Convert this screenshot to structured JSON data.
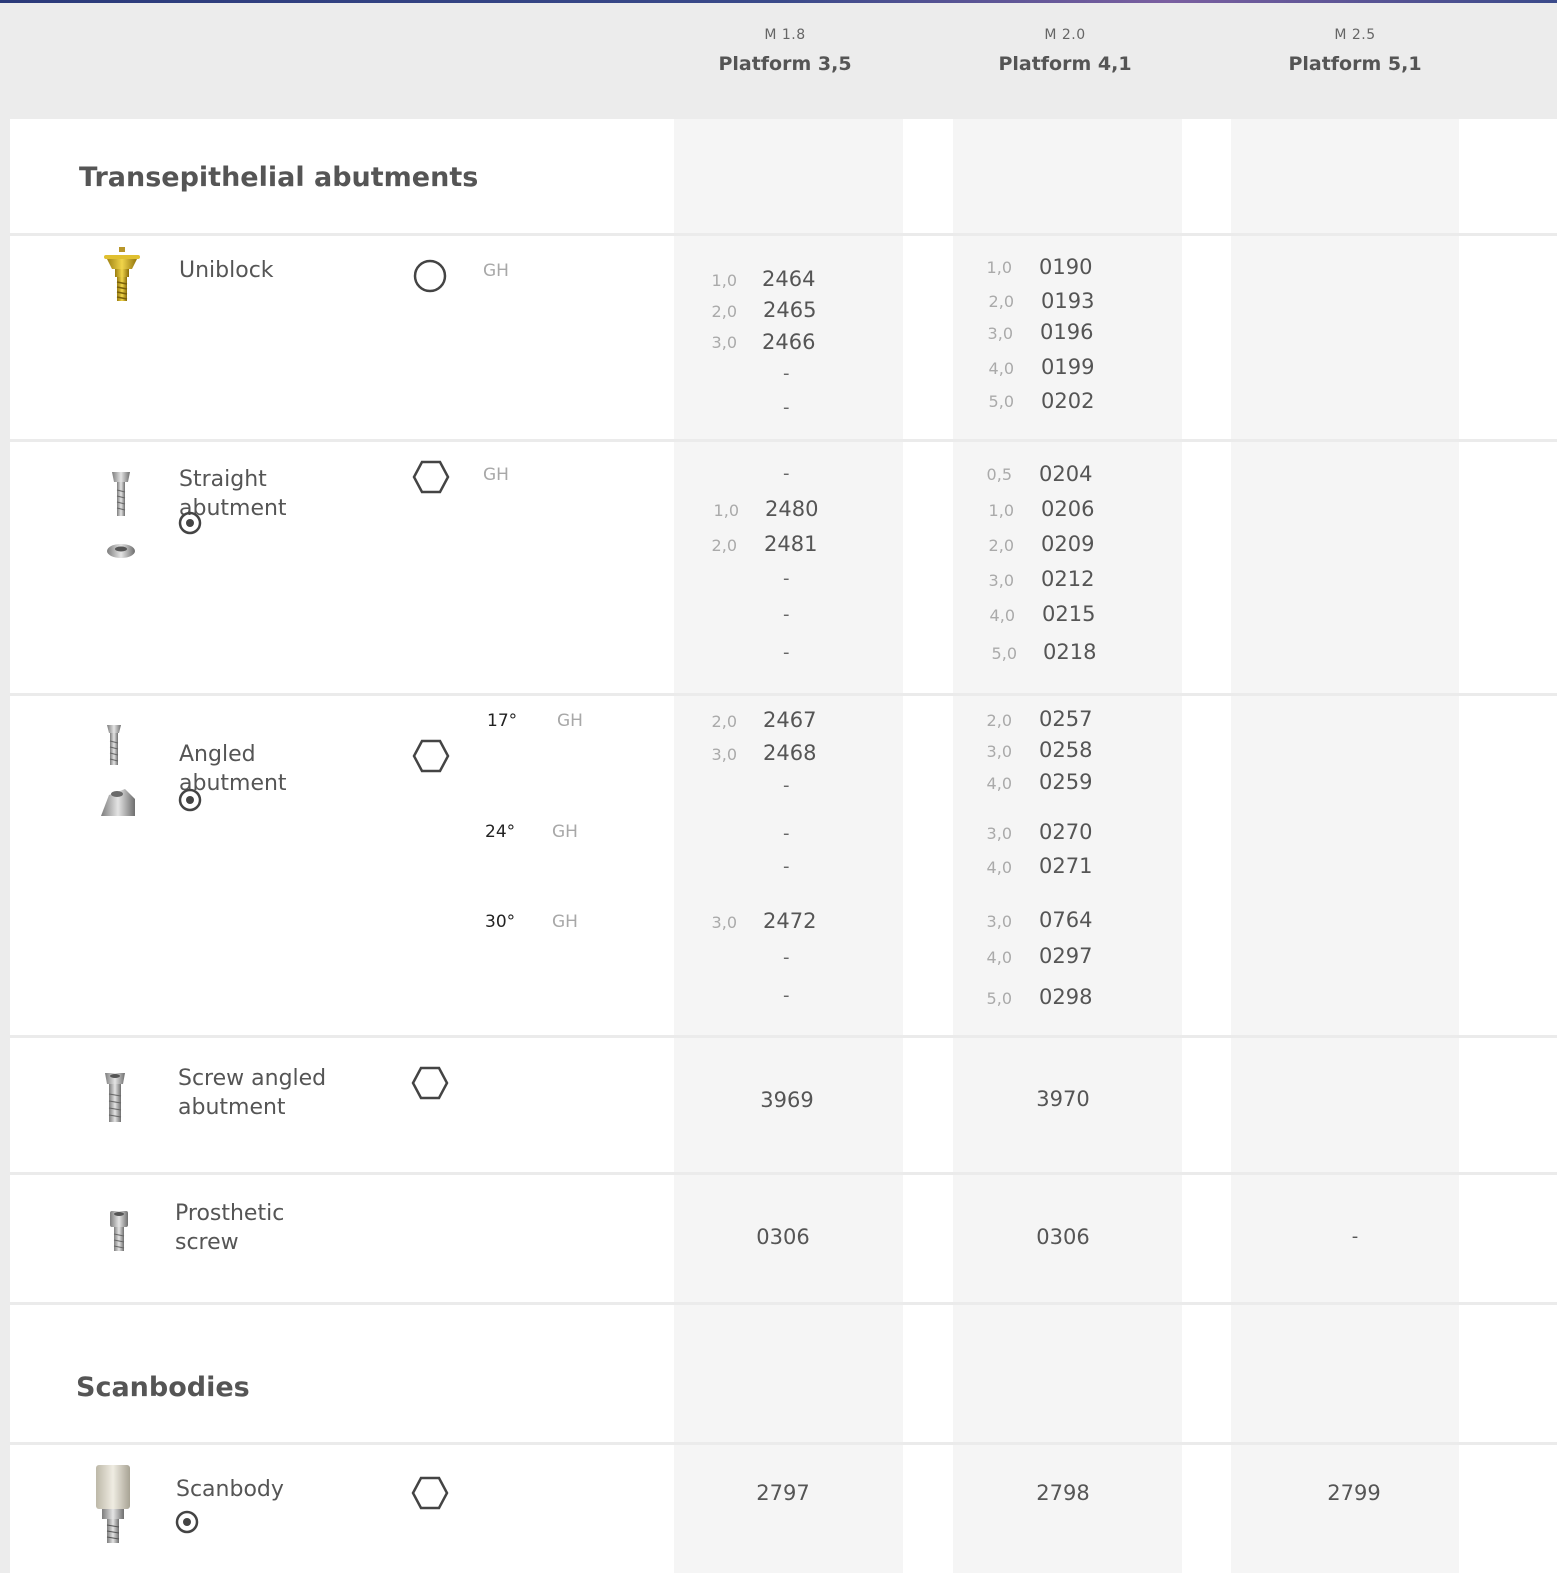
{
  "columns": [
    {
      "m": "M 1.8",
      "platform": "Platform 3,5"
    },
    {
      "m": "M 2.0",
      "platform": "Platform 4,1"
    },
    {
      "m": "M 2.5",
      "platform": "Platform 5,1"
    }
  ],
  "sections": {
    "transepithelial": "Transepithelial abutments",
    "scanbodies": "Scanbodies"
  },
  "icons": {
    "connection_round": "circle-icon",
    "connection_hex": "hexagon-icon",
    "rotational": "target-icon"
  },
  "rows": {
    "uniblock": {
      "name": "Uniblock",
      "gh": "GH",
      "p35": {
        "heights": [
          "1,0",
          "2,0",
          "3,0"
        ],
        "codes": [
          "2464",
          "2465",
          "2466"
        ],
        "dashes": [
          "-",
          "-"
        ]
      },
      "p41": {
        "heights": [
          "1,0",
          "2,0",
          "3,0",
          "4,0",
          "5,0"
        ],
        "codes": [
          "0190",
          "0193",
          "0196",
          "0199",
          "0202"
        ]
      }
    },
    "straight": {
      "name": "Straight abutment",
      "gh": "GH",
      "p35": {
        "dash_top": "-",
        "heights": [
          "1,0",
          "2,0"
        ],
        "codes": [
          "2480",
          "2481"
        ],
        "dashes": [
          "-",
          "-",
          "-"
        ]
      },
      "p41": {
        "heights": [
          "0,5",
          "1,0",
          "2,0",
          "3,0",
          "4,0",
          "5,0"
        ],
        "codes": [
          "0204",
          "0206",
          "0209",
          "0212",
          "0215",
          "0218"
        ]
      }
    },
    "angled": {
      "name": "Angled abutment",
      "angles": [
        "17°",
        "24°",
        "30°"
      ],
      "gh": "GH",
      "p35": {
        "a17": {
          "heights": [
            "2,0",
            "3,0"
          ],
          "codes": [
            "2467",
            "2468"
          ],
          "dash": "-"
        },
        "a24": {
          "dashes": [
            "-",
            "-"
          ]
        },
        "a30": {
          "heights": [
            "3,0"
          ],
          "codes": [
            "2472"
          ],
          "dashes": [
            "-",
            "-"
          ]
        }
      },
      "p41": {
        "a17": {
          "heights": [
            "2,0",
            "3,0",
            "4,0"
          ],
          "codes": [
            "0257",
            "0258",
            "0259"
          ]
        },
        "a24": {
          "heights": [
            "3,0",
            "4,0"
          ],
          "codes": [
            "0270",
            "0271"
          ]
        },
        "a30": {
          "heights": [
            "3,0",
            "4,0",
            "5,0"
          ],
          "codes": [
            "0764",
            "0297",
            "0298"
          ]
        }
      }
    },
    "screw_angled": {
      "name": "Screw angled abutment",
      "p35": "3969",
      "p41": "3970"
    },
    "prosthetic_screw": {
      "name": "Prosthetic screw",
      "p35": "0306",
      "p41": "0306",
      "p51": "-"
    },
    "scanbody": {
      "name": "Scanbody",
      "p35": "2797",
      "p41": "2798",
      "p51": "2799"
    }
  }
}
